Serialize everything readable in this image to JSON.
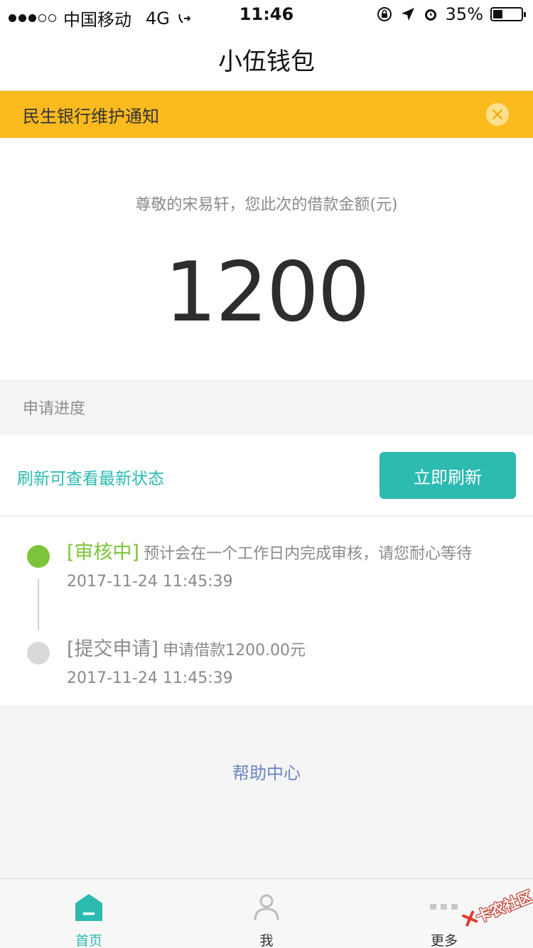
{
  "status_bar": {
    "carrier": "中国移动",
    "network": "4G",
    "time": "11:46",
    "battery": "35%",
    "battery_level": 0.35
  },
  "header": {
    "title": "小伍钱包"
  },
  "notice": {
    "text": "民生银行维护通知"
  },
  "loan": {
    "greeting": "尊敬的宋易轩，您此次的借款金额(元)",
    "amount": "1200"
  },
  "progress": {
    "section_title": "申请进度",
    "refresh_hint": "刷新可查看最新状态",
    "refresh_button": "立即刷新",
    "steps": [
      {
        "status": "[审核中]",
        "desc": "预计会在一个工作日内完成审核，请您耐心等待",
        "time": "2017-11-24 11:45:39",
        "status_color": "#7dc43a",
        "dot_color": "#7dc43a"
      },
      {
        "status": "[提交申请]",
        "desc": "申请借款1200.00元",
        "time": "2017-11-24 11:45:39",
        "status_color": "#8a8a8a",
        "dot_color": "#d9d9d9"
      }
    ]
  },
  "help": {
    "label": "帮助中心"
  },
  "tabbar": {
    "tabs": [
      {
        "label": "首页",
        "icon": "home-icon",
        "active": true
      },
      {
        "label": "我",
        "icon": "user-icon",
        "active": false
      },
      {
        "label": "更多",
        "icon": "more-icon",
        "active": false
      }
    ]
  },
  "watermark": {
    "text": "卡农社区"
  },
  "colors": {
    "accent": "#2cbab1",
    "notice_bg": "#fbbb1f",
    "link": "#6a86c3",
    "status_active": "#7dc43a"
  }
}
